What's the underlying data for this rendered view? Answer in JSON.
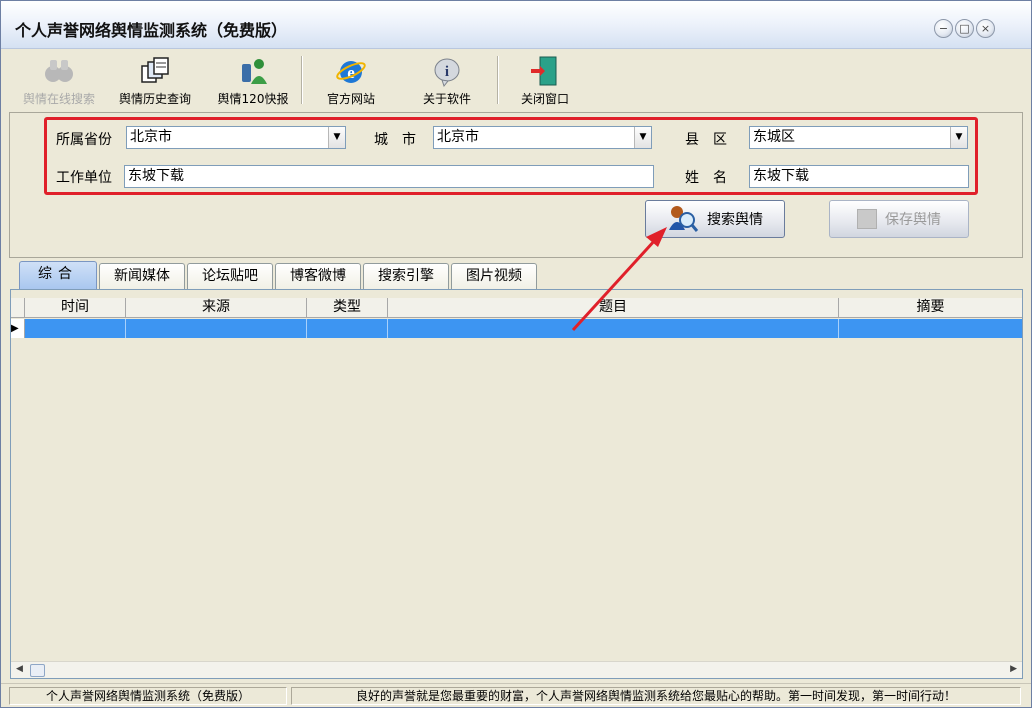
{
  "window": {
    "title": "个人声誉网络舆情监测系统（免费版）"
  },
  "window_controls": {
    "minimize": "−",
    "restore": "□",
    "close": "×"
  },
  "toolbar": {
    "items": [
      {
        "label": "舆情在线搜索",
        "enabled": false,
        "icon": "binoculars-icon"
      },
      {
        "label": "舆情历史查询",
        "enabled": true,
        "icon": "history-windows-icon"
      },
      {
        "label": "舆情120快报",
        "enabled": true,
        "icon": "phone-person-icon"
      },
      {
        "label": "官方网站",
        "enabled": true,
        "icon": "ie-globe-icon"
      },
      {
        "label": "关于软件",
        "enabled": true,
        "icon": "info-icon"
      },
      {
        "label": "关闭窗口",
        "enabled": true,
        "icon": "exit-door-icon"
      }
    ]
  },
  "form": {
    "province_label": "所属省份",
    "province_value": "北京市",
    "city_label": "城　市",
    "city_value": "北京市",
    "county_label": "县　区",
    "county_value": "东城区",
    "work_label": "工作单位",
    "work_value": "东坡下载",
    "name_label": "姓　名",
    "name_value": "东坡下载",
    "search_button": "搜索舆情",
    "save_button": "保存舆情"
  },
  "tabs": [
    {
      "label": "综合",
      "active": true
    },
    {
      "label": "新闻媒体",
      "active": false
    },
    {
      "label": "论坛贴吧",
      "active": false
    },
    {
      "label": "博客微博",
      "active": false
    },
    {
      "label": "搜索引擎",
      "active": false
    },
    {
      "label": "图片视频",
      "active": false
    }
  ],
  "grid": {
    "columns": [
      "时间",
      "来源",
      "类型",
      "题目",
      "摘要"
    ],
    "rows": [
      [
        "",
        "",
        "",
        "",
        ""
      ]
    ]
  },
  "status": {
    "left": "个人声誉网络舆情监测系统（免费版）",
    "right": "良好的声誉就是您最重要的财富，个人声誉网络舆情监测系统给您最贴心的帮助。第一时间发现，第一时间行动！"
  },
  "colors": {
    "highlight_border": "#e0202a",
    "selected_row": "#3d95f2",
    "annotation_arrow": "#e0202a"
  }
}
